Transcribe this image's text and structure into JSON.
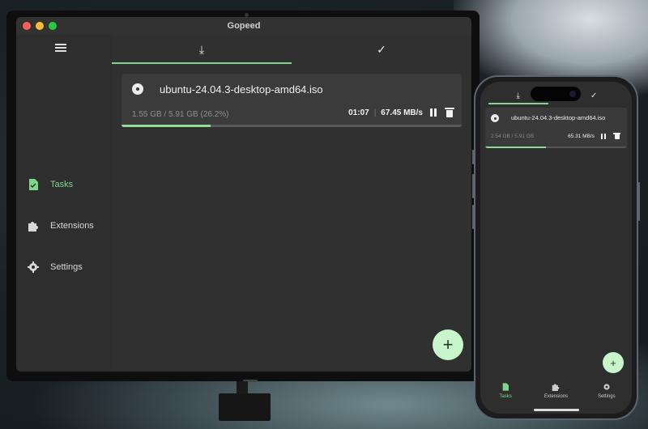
{
  "desktop": {
    "window_title": "Gopeed",
    "sidebar": {
      "items": [
        {
          "label": "Tasks",
          "icon": "task-file-icon",
          "active": true
        },
        {
          "label": "Extensions",
          "icon": "puzzle-icon",
          "active": false
        },
        {
          "label": "Settings",
          "icon": "gear-icon",
          "active": false
        }
      ]
    },
    "tabs": [
      {
        "icon": "download-icon",
        "glyph": "⤓",
        "active": true
      },
      {
        "icon": "check-icon",
        "glyph": "✓",
        "active": false
      }
    ],
    "task": {
      "name": "ubuntu-24.04.3-desktop-amd64.iso",
      "progress_text": "1.55 GB / 5.91 GB (26.2%)",
      "time_left": "01:07",
      "separator": "|",
      "speed": "67.45 MB/s",
      "progress": 0.262
    },
    "fab_label": "+"
  },
  "mobile": {
    "tabs": [
      {
        "icon": "download-icon",
        "glyph": "⤓",
        "active": true
      },
      {
        "icon": "check-icon",
        "glyph": "✓",
        "active": false
      }
    ],
    "task": {
      "name": "ubuntu-24.04.3-desktop-amd64.iso",
      "progress_text": "2.54 GB / 5.91 GB",
      "speed": "65.31 MB/s",
      "progress": 0.43
    },
    "fab_label": "+",
    "bottom_nav": [
      {
        "label": "Tasks",
        "icon": "task-file-icon",
        "active": true
      },
      {
        "label": "Extensions",
        "icon": "puzzle-icon",
        "active": false
      },
      {
        "label": "Settings",
        "icon": "gear-icon",
        "active": false
      }
    ]
  },
  "colors": {
    "accent": "#7dd68a",
    "fab": "#c9f5cd",
    "background": "#303030"
  }
}
